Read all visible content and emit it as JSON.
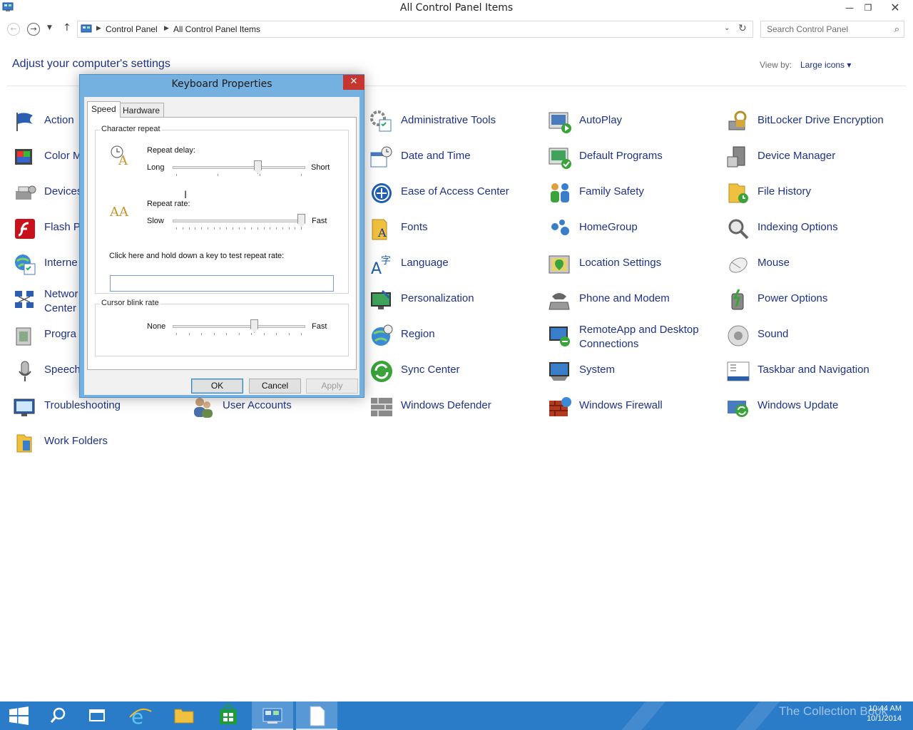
{
  "window": {
    "title": "All Control Panel Items",
    "minimize": "—",
    "maximize": "❐",
    "close": "✕"
  },
  "address": {
    "crumbs": [
      "Control Panel",
      "All Control Panel Items"
    ],
    "search_placeholder": "Search Control Panel"
  },
  "header": {
    "title": "Adjust your computer's settings",
    "view_by_label": "View by:",
    "view_by_value": "Large icons ▾"
  },
  "items": {
    "c1": [
      "Action",
      "Color M",
      "Devices",
      "Flash P",
      "Interne",
      "Networ",
      "Progra",
      "Speech",
      "Troubleshooting",
      "Work Folders"
    ],
    "c1_network_line2": "Center",
    "c2": [
      "User Accounts"
    ],
    "c3": [
      "Administrative Tools",
      "Date and Time",
      "Ease of Access Center",
      "Fonts",
      "Language",
      "Personalization",
      "Region",
      "Sync Center",
      "Windows Defender"
    ],
    "c4": [
      "AutoPlay",
      "Default Programs",
      "Family Safety",
      "HomeGroup",
      "Location Settings",
      "Phone and Modem",
      "RemoteApp and Desktop",
      "System",
      "Windows Firewall"
    ],
    "c4_remote_line2": "Connections",
    "c5": [
      "BitLocker Drive Encryption",
      "Device Manager",
      "File History",
      "Indexing Options",
      "Mouse",
      "Power Options",
      "Sound",
      "Taskbar and Navigation",
      "Windows Update"
    ]
  },
  "dialog": {
    "title": "Keyboard Properties",
    "close": "✕",
    "tabs": [
      "Speed",
      "Hardware"
    ],
    "char_repeat": {
      "group": "Character repeat",
      "delay_label": "Repeat delay:",
      "delay_left": "Long",
      "delay_right": "Short",
      "delay_value": 0.65,
      "rate_label": "Repeat rate:",
      "rate_left": "Slow",
      "rate_right": "Fast",
      "rate_value": 1.0,
      "test_label": "Click here and hold down a key to test repeat rate:",
      "test_value": ""
    },
    "blink": {
      "group": "Cursor blink rate",
      "left": "None",
      "right": "Fast",
      "value": 0.62
    },
    "buttons": {
      "ok": "OK",
      "cancel": "Cancel",
      "apply": "Apply"
    }
  },
  "taskbar": {
    "watermark": "The Collection Book",
    "time": "10:44 AM",
    "date": "10/1/2014"
  }
}
